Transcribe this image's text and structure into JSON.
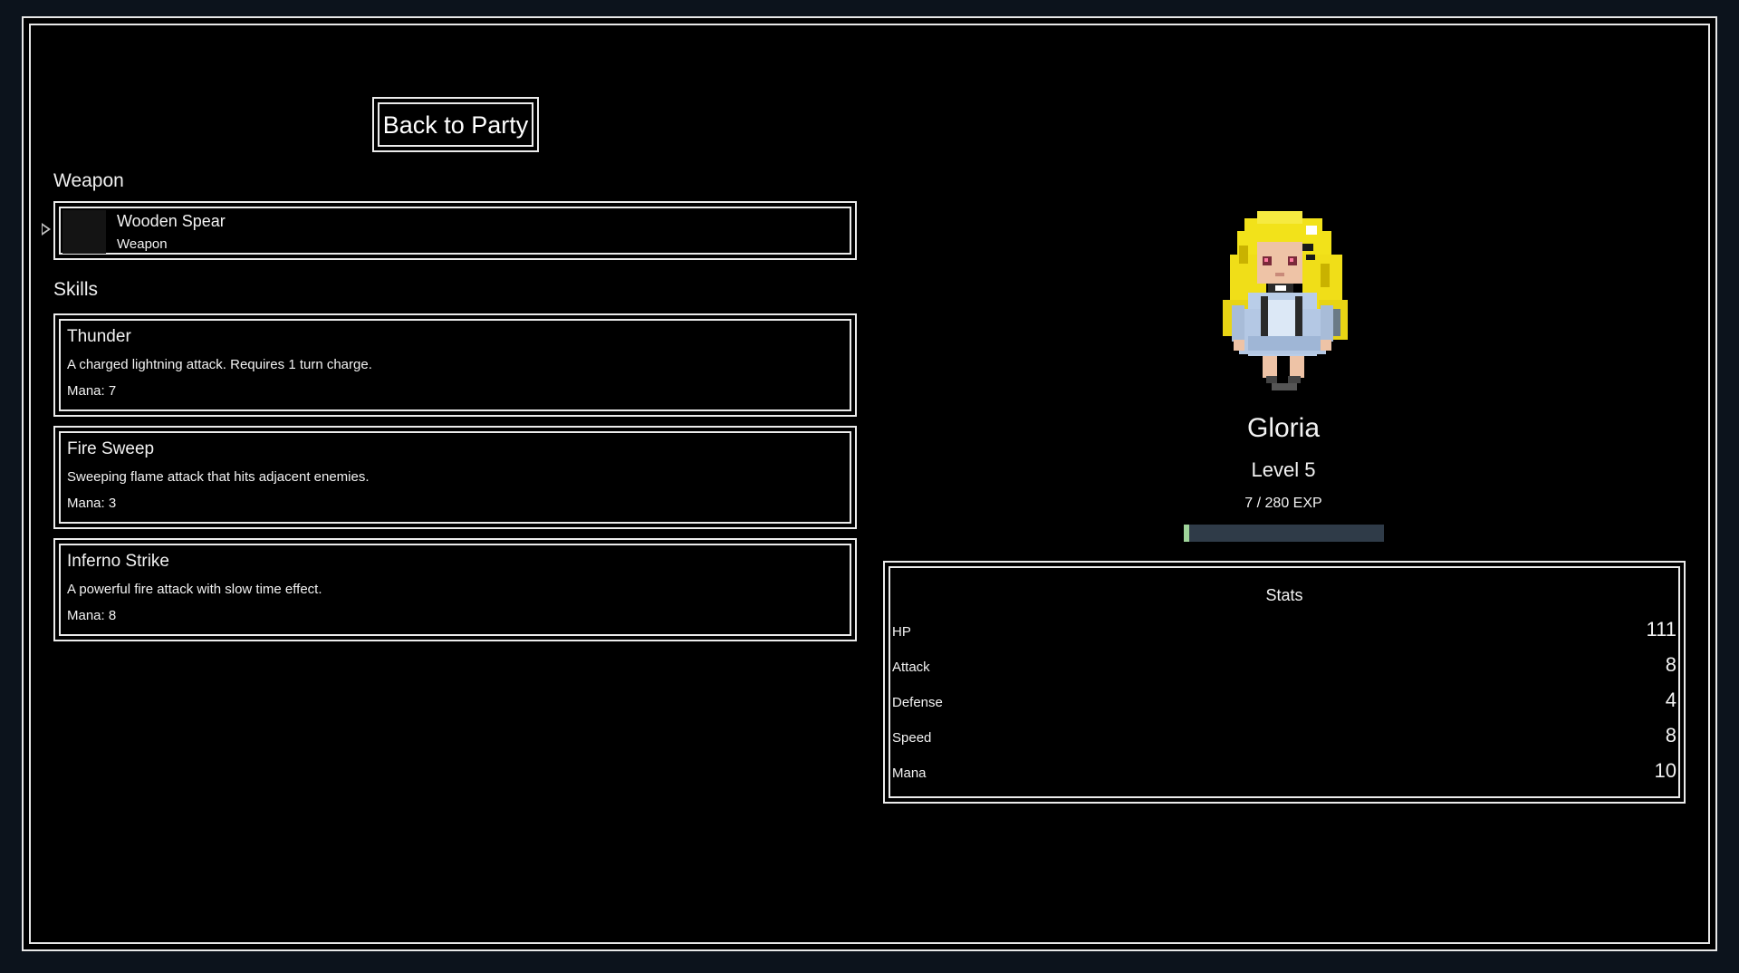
{
  "nav": {
    "back_label": "Back to Party"
  },
  "weapon": {
    "section_label": "Weapon",
    "name": "Wooden Spear",
    "type": "Weapon"
  },
  "skills": {
    "section_label": "Skills",
    "items": [
      {
        "name": "Thunder",
        "description": "A charged lightning attack. Requires 1 turn charge.",
        "mana": "Mana: 7"
      },
      {
        "name": "Fire Sweep",
        "description": "Sweeping flame attack that hits adjacent enemies.",
        "mana": "Mana: 3"
      },
      {
        "name": "Inferno Strike",
        "description": "A powerful fire attack with slow time effect.",
        "mana": "Mana: 8"
      }
    ]
  },
  "character": {
    "name": "Gloria",
    "level": "Level 5",
    "exp_text": "7 / 280 EXP",
    "exp_current": 7,
    "exp_max": 280
  },
  "stats": {
    "title": "Stats",
    "rows": [
      {
        "label": "HP",
        "value": "111"
      },
      {
        "label": "Attack",
        "value": "8"
      },
      {
        "label": "Defense",
        "value": "4"
      },
      {
        "label": "Speed",
        "value": "8"
      },
      {
        "label": "Mana",
        "value": "10"
      }
    ]
  },
  "colors": {
    "background": "#000000",
    "border": "#ececec",
    "exp_fill": "#9fd49a",
    "exp_track": "#2f3b48"
  }
}
